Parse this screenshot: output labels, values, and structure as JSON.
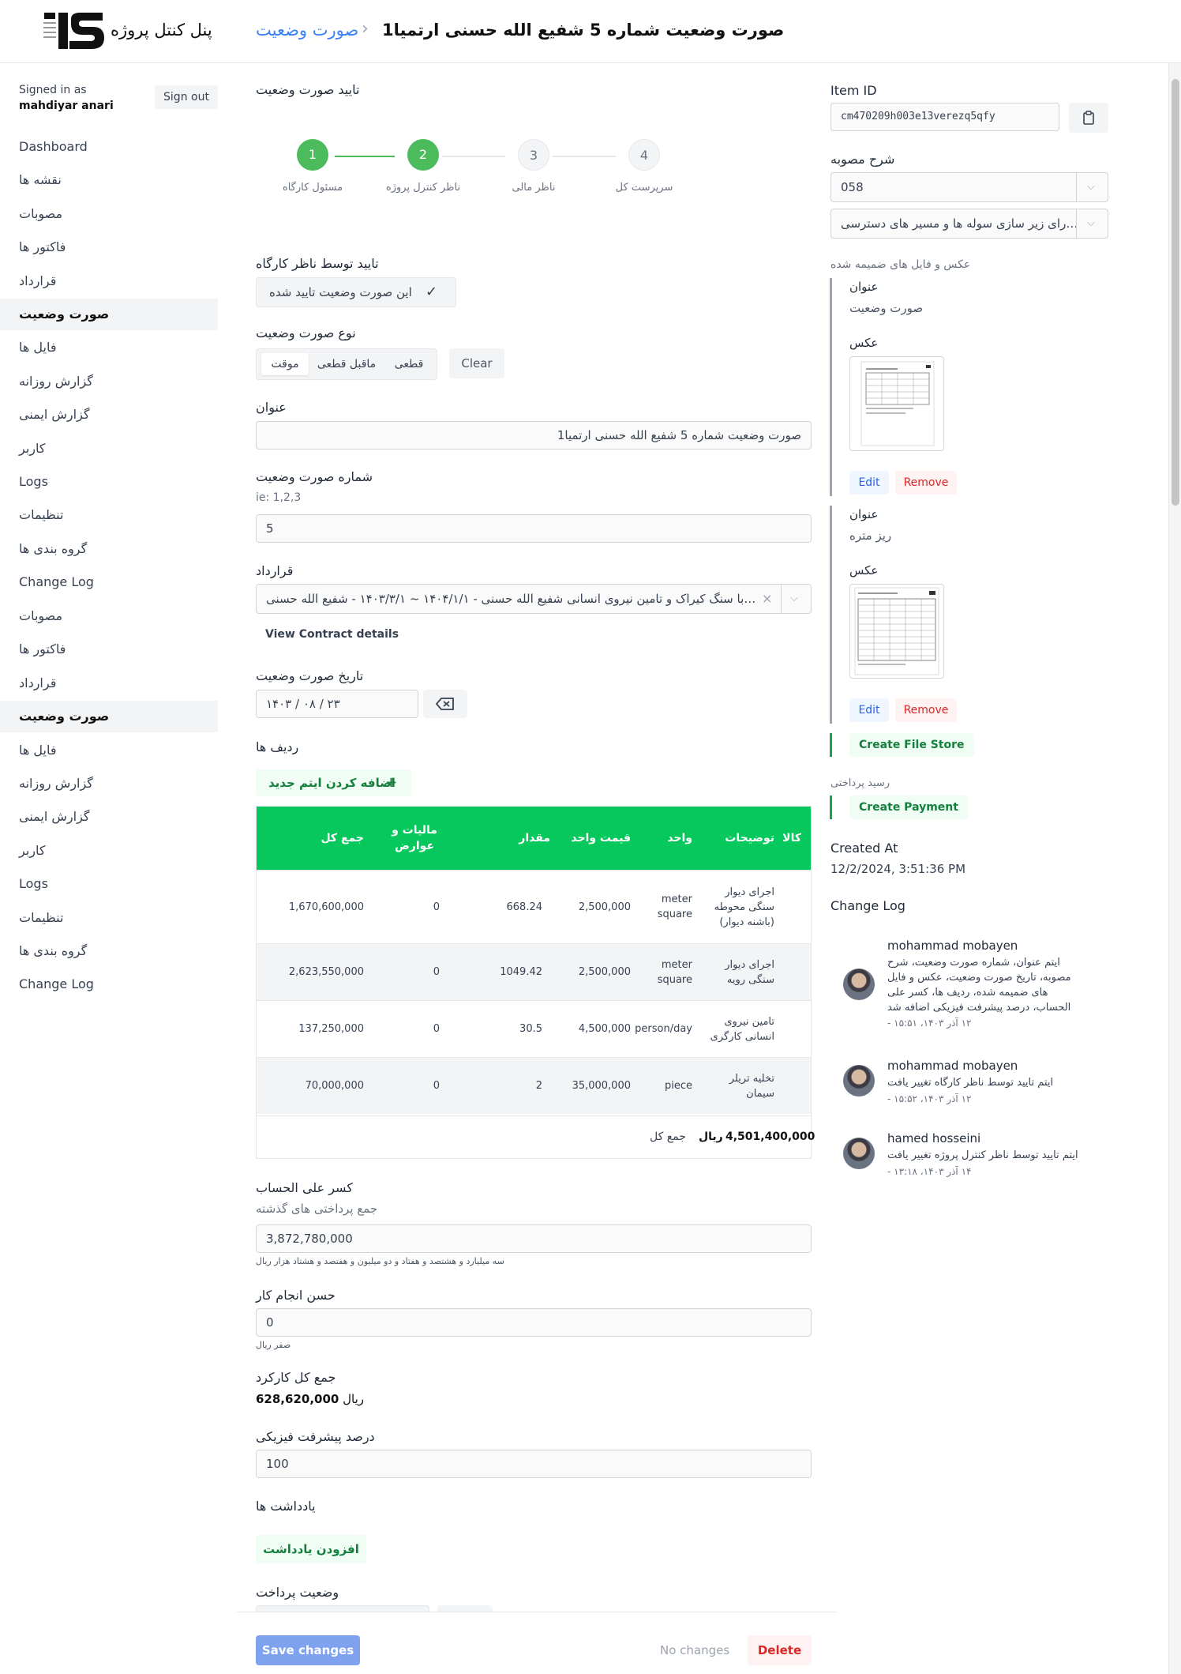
{
  "header": {
    "brand_title": "پنل کنتل پروژه",
    "breadcrumb_link": "صورت وضعیت",
    "breadcrumb_sep": "›",
    "breadcrumb_current": "صورت وضعیت شماره 5 شفیع الله حسنی ارتمیا1",
    "logo_text": "IS"
  },
  "sidebar": {
    "signed_label": "Signed in as",
    "user": "mahdiyar anari",
    "sign_out": "Sign out",
    "items": [
      {
        "label": "Dashboard",
        "active": false
      },
      {
        "label": "نقشه ها",
        "active": false
      },
      {
        "label": "مصوبات",
        "active": false
      },
      {
        "label": "فاکتور ها",
        "active": false
      },
      {
        "label": "قرارداد",
        "active": false
      },
      {
        "label": "صورت وضعیت",
        "active": true
      },
      {
        "label": "فایل ها",
        "active": false
      },
      {
        "label": "گزارش روزانه",
        "active": false
      },
      {
        "label": "گزارش ایمنی",
        "active": false
      },
      {
        "label": "کاربر",
        "active": false
      },
      {
        "label": "Logs",
        "active": false
      },
      {
        "label": "تنظیمات",
        "active": false
      },
      {
        "label": "گروه بندی ها",
        "active": false
      },
      {
        "label": "Change Log",
        "active": false
      }
    ],
    "items_repeat": [
      {
        "label": "مصوبات",
        "active": false
      },
      {
        "label": "فاکتور ها",
        "active": false
      },
      {
        "label": "قرارداد",
        "active": false
      },
      {
        "label": "صورت وضعیت",
        "active": true
      },
      {
        "label": "فایل ها",
        "active": false
      },
      {
        "label": "گزارش روزانه",
        "active": false
      },
      {
        "label": "گزارش ایمنی",
        "active": false
      },
      {
        "label": "کاربر",
        "active": false
      },
      {
        "label": "Logs",
        "active": false
      },
      {
        "label": "تنظیمات",
        "active": false
      },
      {
        "label": "گروه بندی ها",
        "active": false
      },
      {
        "label": "Change Log",
        "active": false
      }
    ]
  },
  "form": {
    "approval_title": "تایید صورت وضعیت",
    "steps": [
      {
        "num": "1",
        "label": "مسئول کارگاه",
        "done": true
      },
      {
        "num": "2",
        "label": "ناظر کنترل پروژه",
        "done": true
      },
      {
        "num": "3",
        "label": "ناظر مالی",
        "done": false
      },
      {
        "num": "4",
        "label": "سرپرست کل",
        "done": false
      }
    ],
    "supervisor_approval_label": "تایید توسط ناظر کارگاه",
    "supervisor_approval_value": "این صورت وضعیت تایید شده",
    "type_label": "نوع صورت وضعیت",
    "type_options": [
      "قطعی",
      "ماقبل قطعی",
      "موقت"
    ],
    "type_selected": "موقت",
    "clear_label": "Clear",
    "title_label": "عنوان",
    "title_value": "صورت وضعیت شماره 5 شفیع الله حسنی ارتمیا1",
    "number_label": "شماره صورت وضعیت",
    "number_hint": "ie: 1,2,3",
    "number_value": "5",
    "contract_label": "قرارداد",
    "contract_value": "…با سنگ کیراک و تامین نیروی انسانی شفیع الله حسنی - ۱۴۰۴/۱/۱ ~ ۱۴۰۳/۳/۱ - شفیع الله حسنی",
    "contract_link": "View Contract details",
    "date_label": "تاریخ صورت وضعیت",
    "date_value": "۱۴۰۳ / ۰۸ / ۲۳",
    "rows_label": "ردیف ها",
    "add_item_label": "اضافه کردن ایتم جدید",
    "deduction_label": "کسر علی الحساب",
    "deduction_hint": "جمع پرداختی های گذشته",
    "deduction_value": "3,872,780,000",
    "deduction_words": "سه میلیارد و هشتصد و هفتاد و دو میلیون و هفتصد و هشتاد هزار ریال",
    "good_perf_label": "حسن انجام کار",
    "good_perf_value": "0",
    "good_perf_words": "صفر ریال",
    "total_work_label": "جمع کل کارکرد",
    "total_work_value": "628,620,000",
    "total_work_unit": "ریال",
    "progress_label": "درصد پیشرفت فیزیکی",
    "progress_value": "100",
    "notes_label": "یادداشت ها",
    "add_note_label": "افزودن یادداشت",
    "payment_status_label": "وضعیت پرداخت"
  },
  "table": {
    "headers": {
      "total": "جمع کل",
      "tax": "مالیات و عوارض",
      "qty": "مقدار",
      "unit_price": "قیمت واحد",
      "unit": "واحد",
      "desc": "توضیحات",
      "item": "کالا"
    },
    "rows": [
      {
        "total": "1,670,600,000",
        "tax": "0",
        "qty": "668.24",
        "unit_price": "2,500,000",
        "unit": "meter square",
        "desc": "اجرای دیوار سنگی محوطه (باشنه دیوار)"
      },
      {
        "total": "2,623,550,000",
        "tax": "0",
        "qty": "1049.42",
        "unit_price": "2,500,000",
        "unit": "meter square",
        "desc": "اجرای دیوار سنگی رویه"
      },
      {
        "total": "137,250,000",
        "tax": "0",
        "qty": "30.5",
        "unit_price": "4,500,000",
        "unit": "person/day",
        "desc": "تامین نیروی انسانی کارگری"
      },
      {
        "total": "70,000,000",
        "tax": "0",
        "qty": "2",
        "unit_price": "35,000,000",
        "unit": "piece",
        "desc": "تخلیه تریلر سیمان"
      }
    ],
    "grand_total": "4,501,400,000",
    "grand_total_unit": "ریال",
    "grand_total_label": "جمع کل"
  },
  "right": {
    "item_id_label": "Item ID",
    "item_id_value": "cm470209h003e13verezq5qfy",
    "approval_desc_label": "شرح مصوبه",
    "approval_desc_code": "058",
    "approval_desc_text": "…رای زیر سازی سوله ها و مسیر های دسترسی",
    "attachments_label": "عکس و فایل های ضمیمه شده",
    "attachments": [
      {
        "title_label": "عنوان",
        "title": "صورت وضعیت",
        "image_label": "عکس",
        "edit": "Edit",
        "remove": "Remove"
      },
      {
        "title_label": "عنوان",
        "title": "ریز متره",
        "image_label": "عکس",
        "edit": "Edit",
        "remove": "Remove"
      }
    ],
    "create_file_store": "Create File Store",
    "receipt_label": "رسید پرداختی",
    "create_payment": "Create Payment",
    "created_at_label": "Created At",
    "created_at_value": "12/2/2024, 3:51:36 PM",
    "change_log_label": "Change Log",
    "logs": [
      {
        "user": "mohammad mobayen",
        "text": "ایتم عنوان، شماره صورت وضعیت، شرح مصوبه، تاریخ صورت وضعیت، عکس و فایل های ضمیمه شده، ردیف ها، کسر علی الحساب، درصد پیشرفت فیزیکی اضافه شد",
        "date": "۱۲ آذر ۱۴۰۳، ۱۵:۵۱ -"
      },
      {
        "user": "mohammad mobayen",
        "text": "ایتم تایید توسط ناظر کارگاه تغییر یافت",
        "date": "۱۲ آذر ۱۴۰۳، ۱۵:۵۲ -"
      },
      {
        "user": "hamed hosseini",
        "text": "ایتم تایید توسط ناظر کنترل پروژه تغییر یافت",
        "date": "۱۴ آذر ۱۴۰۳، ۱۳:۱۸ -"
      }
    ]
  },
  "footer": {
    "save": "Save changes",
    "no_changes": "No changes",
    "delete": "Delete"
  },
  "colors": {
    "accent_blue": "#3b82f6",
    "green": "#4cbb5b",
    "table_header": "#06c85d",
    "danger": "#dc2626"
  }
}
